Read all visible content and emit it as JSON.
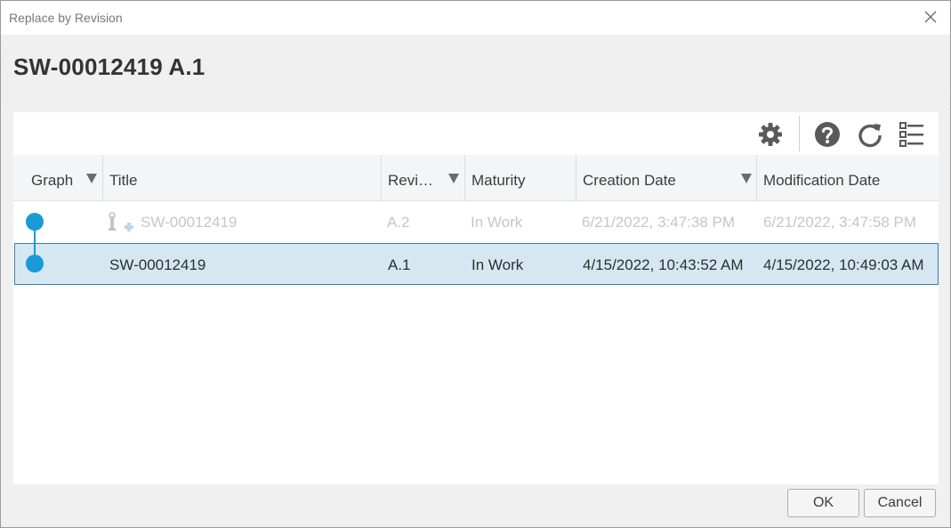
{
  "window": {
    "title": "Replace by Revision"
  },
  "object": {
    "name": "SW-00012419 A.1"
  },
  "toolbar": {
    "icons": [
      "gear-icon",
      "help-icon",
      "refresh-icon",
      "list-view-icon"
    ]
  },
  "grid": {
    "columns": [
      {
        "label": "Graph",
        "filter": true
      },
      {
        "label": "Title",
        "filter": false
      },
      {
        "label": "Revi…",
        "filter": true
      },
      {
        "label": "Maturity",
        "filter": false
      },
      {
        "label": "Creation Date",
        "filter": true
      },
      {
        "label": "Modification Date",
        "filter": false
      }
    ],
    "rows": [
      {
        "title": "SW-00012419",
        "revision": "A.2",
        "maturity": "In Work",
        "created": "6/21/2022, 3:47:38 PM",
        "modified": "6/21/2022, 3:47:58 PM",
        "state": "dimmed"
      },
      {
        "title": "SW-00012419",
        "revision": "A.1",
        "maturity": "In Work",
        "created": "4/15/2022, 10:43:52 AM",
        "modified": "4/15/2022, 10:49:03 AM",
        "state": "selected"
      }
    ]
  },
  "colors": {
    "graph_node": "#1a9bd7",
    "selected_row": "#d5e8f2",
    "selected_border": "#3c7fb1"
  },
  "buttons": {
    "ok": "OK",
    "cancel": "Cancel"
  }
}
